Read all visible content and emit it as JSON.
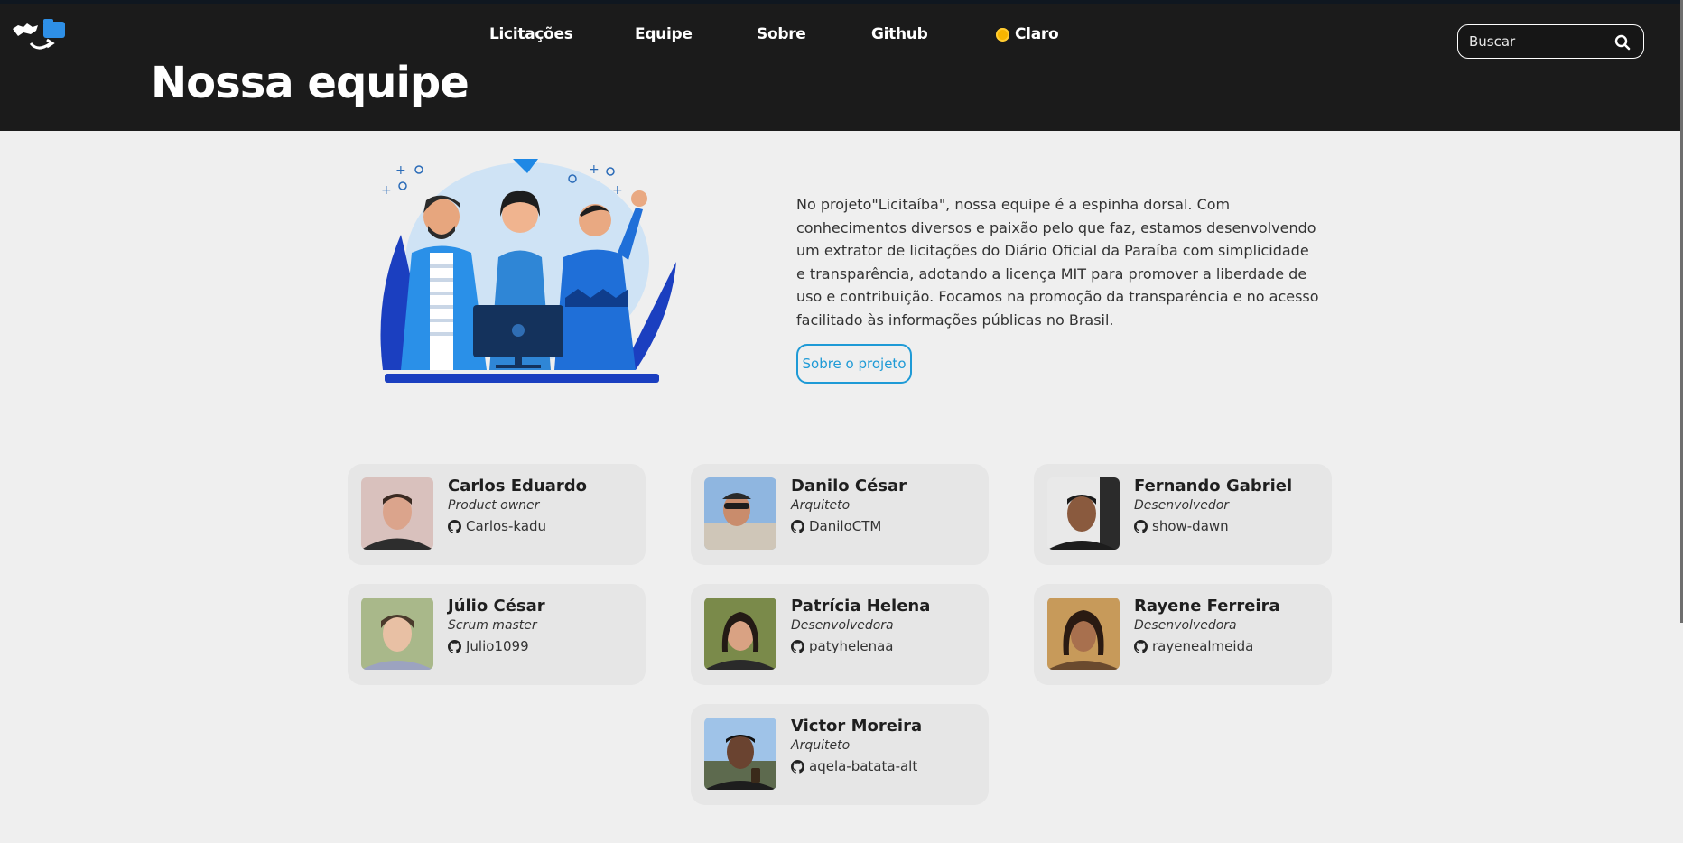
{
  "header": {
    "nav": [
      "Licitações",
      "Equipe",
      "Sobre",
      "Github"
    ],
    "theme_label": "Claro",
    "search_placeholder": "Buscar",
    "page_title": "Nossa equipe"
  },
  "about": {
    "text": "No projeto\"Licitaíba\", nossa equipe é a espinha dorsal. Com conhecimentos diversos e paixão pelo que faz, estamos desenvolvendo um extrator de licitações do Diário Oficial da Paraíba com simplicidade e transparência, adotando a licença MIT para promover a liberdade de uso e contribuição. Focamos na promoção da transparência e no acesso facilitado às informações públicas no Brasil.",
    "button": "Sobre o projeto"
  },
  "team": [
    {
      "name": "Carlos Eduardo",
      "role": "Product owner",
      "github": "Carlos-kadu"
    },
    {
      "name": "Danilo César",
      "role": "Arquiteto",
      "github": "DaniloCTM"
    },
    {
      "name": "Fernando Gabriel",
      "role": "Desenvolvedor",
      "github": "show-dawn"
    },
    {
      "name": "Júlio César",
      "role": "Scrum master",
      "github": "Julio1099"
    },
    {
      "name": "Patrícia Helena",
      "role": "Desenvolvedora",
      "github": "patyhelenaa"
    },
    {
      "name": "Rayene Ferreira",
      "role": "Desenvolvedora",
      "github": "rayenealmeida"
    },
    {
      "name": "Victor Moreira",
      "role": "Arquiteto",
      "github": "aqela-batata-alt"
    }
  ],
  "icons": {
    "logo": "logo-icon",
    "theme": "sun-icon",
    "search": "search-icon",
    "github": "github-icon"
  },
  "colors": {
    "header_bg": "#1b1b1b",
    "page_bg": "#efefef",
    "card_bg": "#e6e6e6",
    "accent": "#1e9ad6"
  }
}
